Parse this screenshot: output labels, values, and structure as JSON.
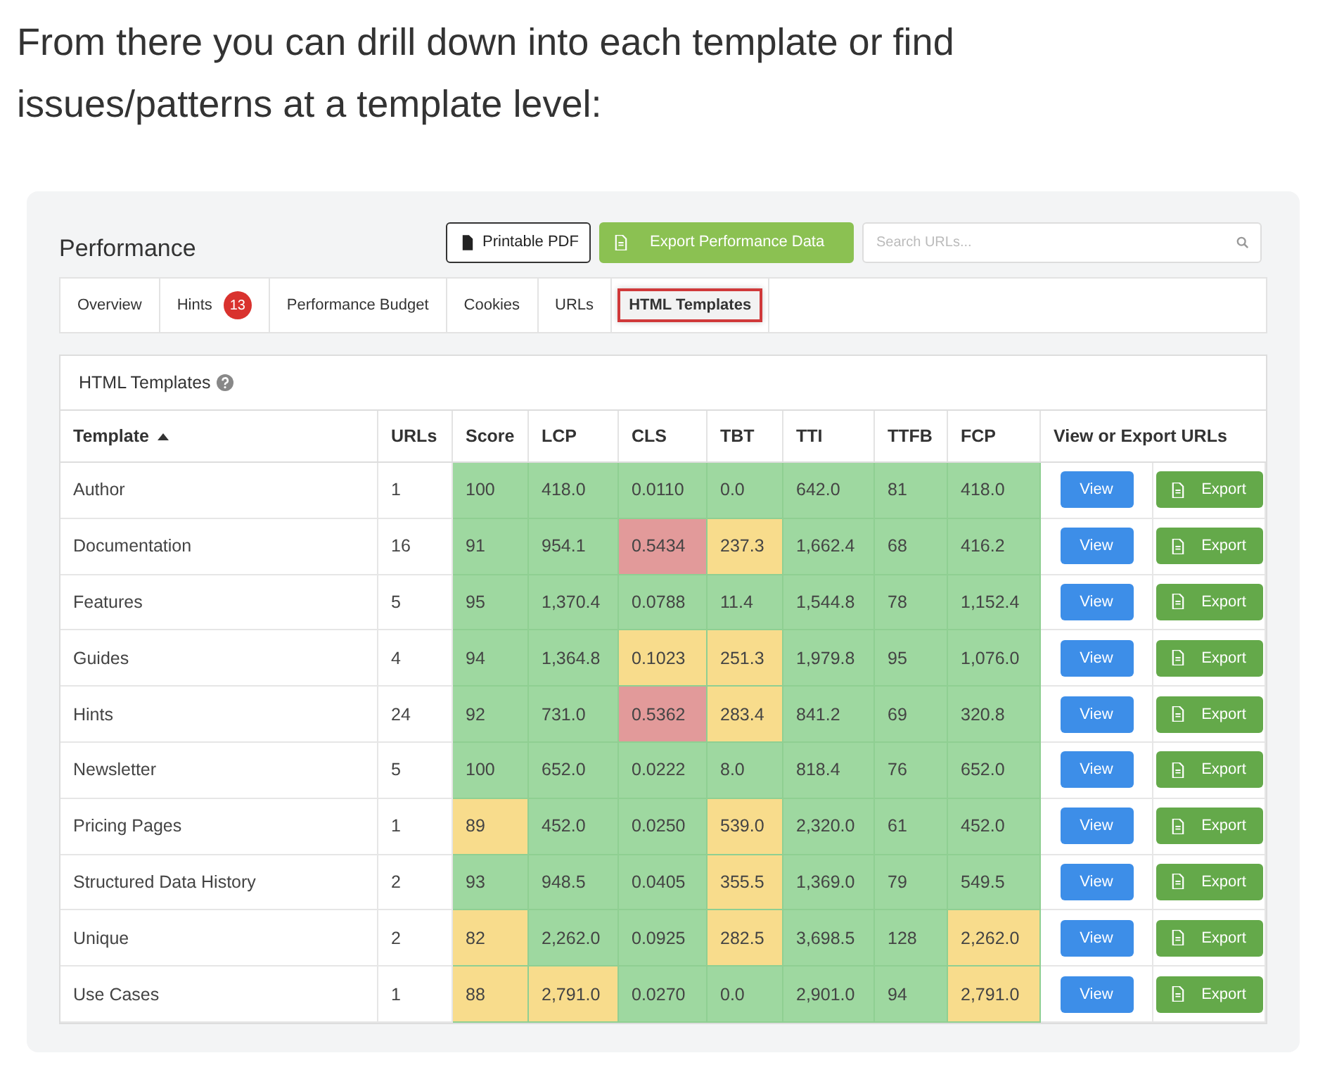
{
  "intro": "From there you can drill down into each template or find issues/patterns at a template level:",
  "title": "Performance",
  "actions": [
    {
      "label": "Printable PDF",
      "kind": "outline"
    },
    {
      "label": "Export Performance Data",
      "kind": "green"
    }
  ],
  "search": {
    "placeholder": "Search URLs..."
  },
  "tabs": [
    {
      "label": "Overview",
      "selected": false
    },
    {
      "label": "Hints",
      "badge": "13",
      "selected": false
    },
    {
      "label": "Performance Budget",
      "selected": false
    },
    {
      "label": "Cookies",
      "selected": false
    },
    {
      "label": "URLs",
      "selected": false
    },
    {
      "label": "HTML Templates",
      "selected": true
    }
  ],
  "panel": {
    "title": "HTML Templates",
    "columns": [
      "Template",
      "URLs",
      "Score",
      "LCP",
      "CLS",
      "TBT",
      "TTI",
      "TTFB",
      "FCP",
      "View or Export URLs"
    ],
    "rows": [
      {
        "name": "Author",
        "urls": "1",
        "metrics": [
          {
            "text": "100",
            "color": "#9ed8a0"
          },
          {
            "text": "418.0",
            "color": "#9ed8a0"
          },
          {
            "text": "0.0110",
            "color": "#9ed8a0"
          },
          {
            "text": "0.0",
            "color": "#9ed8a0"
          },
          {
            "text": "642.0",
            "color": "#9ed8a0"
          },
          {
            "text": "81",
            "color": "#9ed8a0"
          },
          {
            "text": "418.0",
            "color": "#9ed8a0"
          }
        ],
        "view": "View",
        "export": "Export"
      },
      {
        "name": "Documentation",
        "urls": "16",
        "metrics": [
          {
            "text": "91",
            "color": "#9ed8a0"
          },
          {
            "text": "954.1",
            "color": "#9ed8a0"
          },
          {
            "text": "0.5434",
            "color": "#e29a9a"
          },
          {
            "text": "237.3",
            "color": "#f8dc8c"
          },
          {
            "text": "1,662.4",
            "color": "#9ed8a0"
          },
          {
            "text": "68",
            "color": "#9ed8a0"
          },
          {
            "text": "416.2",
            "color": "#9ed8a0"
          }
        ],
        "view": "View",
        "export": "Export"
      },
      {
        "name": "Features",
        "urls": "5",
        "metrics": [
          {
            "text": "95",
            "color": "#9ed8a0"
          },
          {
            "text": "1,370.4",
            "color": "#9ed8a0"
          },
          {
            "text": "0.0788",
            "color": "#9ed8a0"
          },
          {
            "text": "11.4",
            "color": "#9ed8a0"
          },
          {
            "text": "1,544.8",
            "color": "#9ed8a0"
          },
          {
            "text": "78",
            "color": "#9ed8a0"
          },
          {
            "text": "1,152.4",
            "color": "#9ed8a0"
          }
        ],
        "view": "View",
        "export": "Export"
      },
      {
        "name": "Guides",
        "urls": "4",
        "metrics": [
          {
            "text": "94",
            "color": "#9ed8a0"
          },
          {
            "text": "1,364.8",
            "color": "#9ed8a0"
          },
          {
            "text": "0.1023",
            "color": "#f8dc8c"
          },
          {
            "text": "251.3",
            "color": "#f8dc8c"
          },
          {
            "text": "1,979.8",
            "color": "#9ed8a0"
          },
          {
            "text": "95",
            "color": "#9ed8a0"
          },
          {
            "text": "1,076.0",
            "color": "#9ed8a0"
          }
        ],
        "view": "View",
        "export": "Export"
      },
      {
        "name": "Hints",
        "urls": "24",
        "metrics": [
          {
            "text": "92",
            "color": "#9ed8a0"
          },
          {
            "text": "731.0",
            "color": "#9ed8a0"
          },
          {
            "text": "0.5362",
            "color": "#e29a9a"
          },
          {
            "text": "283.4",
            "color": "#f8dc8c"
          },
          {
            "text": "841.2",
            "color": "#9ed8a0"
          },
          {
            "text": "69",
            "color": "#9ed8a0"
          },
          {
            "text": "320.8",
            "color": "#9ed8a0"
          }
        ],
        "view": "View",
        "export": "Export"
      },
      {
        "name": "Newsletter",
        "urls": "5",
        "metrics": [
          {
            "text": "100",
            "color": "#9ed8a0"
          },
          {
            "text": "652.0",
            "color": "#9ed8a0"
          },
          {
            "text": "0.0222",
            "color": "#9ed8a0"
          },
          {
            "text": "8.0",
            "color": "#9ed8a0"
          },
          {
            "text": "818.4",
            "color": "#9ed8a0"
          },
          {
            "text": "76",
            "color": "#9ed8a0"
          },
          {
            "text": "652.0",
            "color": "#9ed8a0"
          }
        ],
        "view": "View",
        "export": "Export"
      },
      {
        "name": "Pricing Pages",
        "urls": "1",
        "metrics": [
          {
            "text": "89",
            "color": "#f8dc8c"
          },
          {
            "text": "452.0",
            "color": "#9ed8a0"
          },
          {
            "text": "0.0250",
            "color": "#9ed8a0"
          },
          {
            "text": "539.0",
            "color": "#f8dc8c"
          },
          {
            "text": "2,320.0",
            "color": "#9ed8a0"
          },
          {
            "text": "61",
            "color": "#9ed8a0"
          },
          {
            "text": "452.0",
            "color": "#9ed8a0"
          }
        ],
        "view": "View",
        "export": "Export"
      },
      {
        "name": "Structured Data History",
        "urls": "2",
        "metrics": [
          {
            "text": "93",
            "color": "#9ed8a0"
          },
          {
            "text": "948.5",
            "color": "#9ed8a0"
          },
          {
            "text": "0.0405",
            "color": "#9ed8a0"
          },
          {
            "text": "355.5",
            "color": "#f8dc8c"
          },
          {
            "text": "1,369.0",
            "color": "#9ed8a0"
          },
          {
            "text": "79",
            "color": "#9ed8a0"
          },
          {
            "text": "549.5",
            "color": "#9ed8a0"
          }
        ],
        "view": "View",
        "export": "Export"
      },
      {
        "name": "Unique",
        "urls": "2",
        "metrics": [
          {
            "text": "82",
            "color": "#f8dc8c"
          },
          {
            "text": "2,262.0",
            "color": "#9ed8a0"
          },
          {
            "text": "0.0925",
            "color": "#9ed8a0"
          },
          {
            "text": "282.5",
            "color": "#f8dc8c"
          },
          {
            "text": "3,698.5",
            "color": "#9ed8a0"
          },
          {
            "text": "128",
            "color": "#9ed8a0"
          },
          {
            "text": "2,262.0",
            "color": "#f8dc8c"
          }
        ],
        "view": "View",
        "export": "Export"
      },
      {
        "name": "Use Cases",
        "urls": "1",
        "metrics": [
          {
            "text": "88",
            "color": "#f8dc8c"
          },
          {
            "text": "2,791.0",
            "color": "#f8dc8c"
          },
          {
            "text": "0.0270",
            "color": "#9ed8a0"
          },
          {
            "text": "0.0",
            "color": "#9ed8a0"
          },
          {
            "text": "2,901.0",
            "color": "#9ed8a0"
          },
          {
            "text": "94",
            "color": "#9ed8a0"
          },
          {
            "text": "2,791.0",
            "color": "#f8dc8c"
          }
        ],
        "view": "View",
        "export": "Export"
      }
    ]
  }
}
